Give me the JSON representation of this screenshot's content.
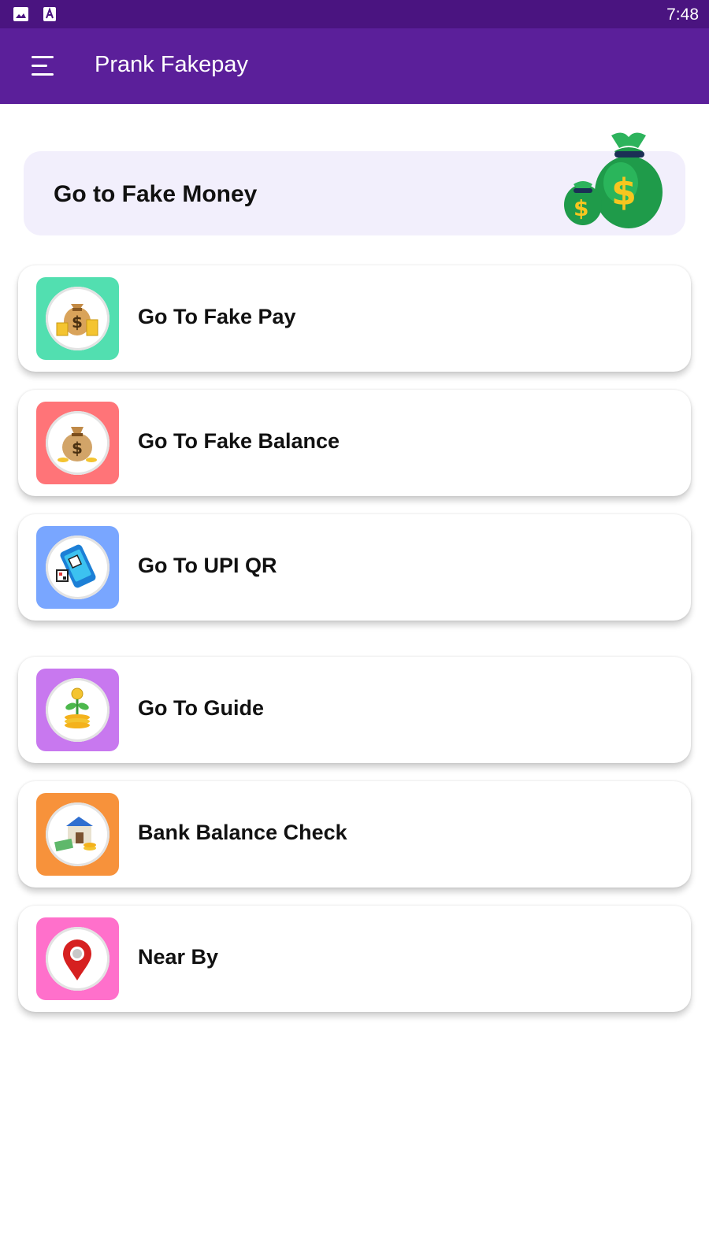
{
  "status_bar": {
    "time": "7:48",
    "icons": [
      "gallery-icon",
      "font-a-icon"
    ]
  },
  "app_bar": {
    "menu_icon": "hamburger-menu-icon",
    "title": "Prank Fakepay",
    "background": "#5b1f9a"
  },
  "hero": {
    "label": "Go to Fake Money",
    "icon": "money-bags-icon",
    "background": "#f2effc"
  },
  "menu": [
    {
      "label": "Go To Fake Pay",
      "icon": "money-bag-coins-icon",
      "tile_color": "#52dfb0"
    },
    {
      "label": "Go To Fake Balance",
      "icon": "money-sack-icon",
      "tile_color": "#ff7478"
    },
    {
      "label": "Go To UPI QR",
      "icon": "phone-qr-icon",
      "tile_color": "#79a6ff"
    },
    {
      "label": "Go To Guide",
      "icon": "coin-plant-icon",
      "tile_color": "#c878ef"
    },
    {
      "label": "Bank Balance Check",
      "icon": "bank-cash-icon",
      "tile_color": "#f7923b"
    },
    {
      "label": "Near By",
      "icon": "location-pin-icon",
      "tile_color": "#ff70cb"
    }
  ]
}
